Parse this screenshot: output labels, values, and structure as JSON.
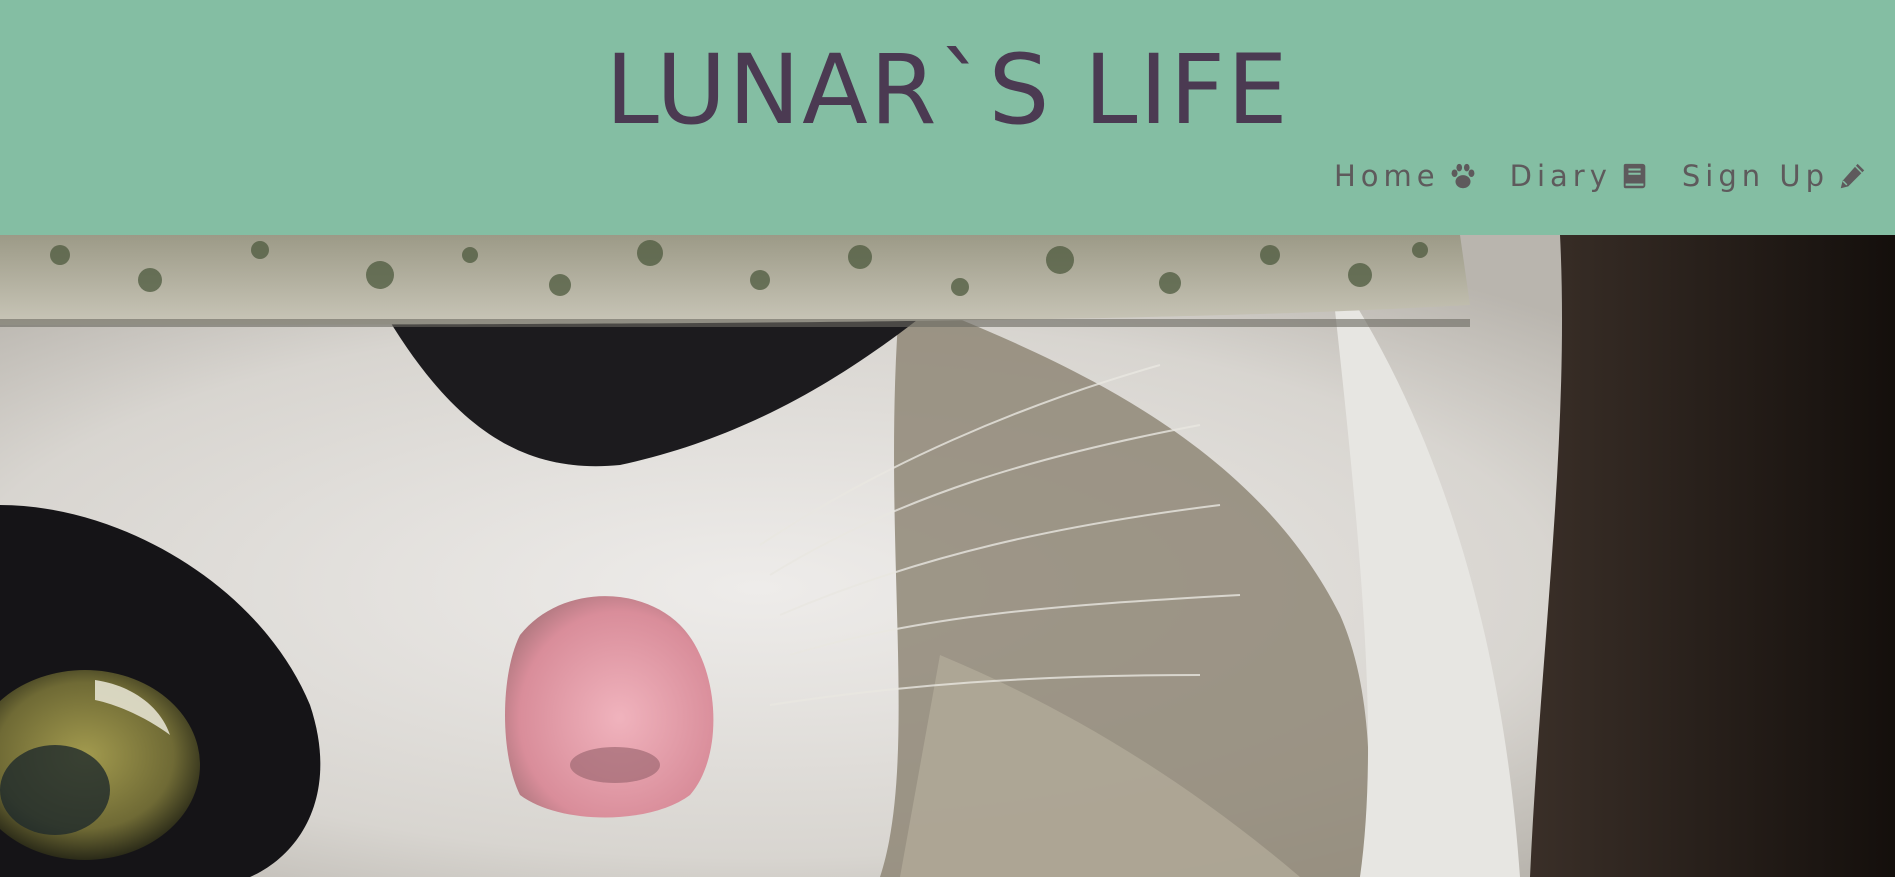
{
  "site": {
    "title": "LUNAR`S LIFE"
  },
  "nav": {
    "items": [
      {
        "label": "Home",
        "icon": "paw-icon"
      },
      {
        "label": "Diary",
        "icon": "book-icon"
      },
      {
        "label": "Sign Up",
        "icon": "pencil-icon"
      }
    ]
  },
  "hero": {
    "image": "cat-closeup-photo"
  },
  "colors": {
    "header_bg": "#84bea3",
    "title": "#4b3a52",
    "nav_text": "#5e5a5c"
  }
}
